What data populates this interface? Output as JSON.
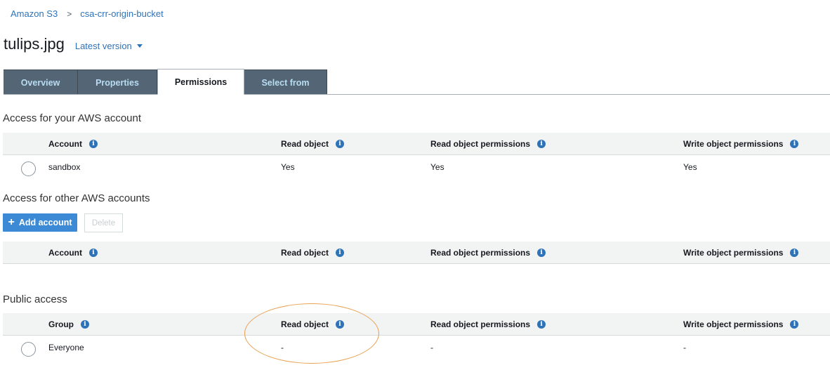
{
  "breadcrumb": {
    "root": "Amazon S3",
    "separator": ">",
    "bucket": "csa-crr-origin-bucket"
  },
  "object": {
    "name": "tulips.jpg",
    "version_label": "Latest version"
  },
  "tabs": [
    {
      "label": "Overview"
    },
    {
      "label": "Properties"
    },
    {
      "label": "Permissions"
    },
    {
      "label": "Select from"
    }
  ],
  "active_tab": "Permissions",
  "info_glyph": "i",
  "columns": {
    "account": "Account",
    "group": "Group",
    "read_object": "Read object",
    "read_perms": "Read object permissions",
    "write_perms": "Write object permissions"
  },
  "your_account": {
    "title": "Access for your AWS account",
    "rows": [
      {
        "name": "sandbox",
        "read": "Yes",
        "read_perms": "Yes",
        "write_perms": "Yes"
      }
    ]
  },
  "other_accounts": {
    "title": "Access for other AWS accounts",
    "add_label": "Add account",
    "add_glyph": "+",
    "delete_label": "Delete"
  },
  "public_access": {
    "title": "Public access",
    "rows": [
      {
        "name": "Everyone",
        "read": "-",
        "read_perms": "-",
        "write_perms": "-"
      }
    ]
  },
  "colors": {
    "link": "#2e73b8",
    "tab_bg": "#546575",
    "tab_text": "#b8dcf2",
    "primary": "#3c8ad6",
    "annotation": "#e8a153"
  }
}
